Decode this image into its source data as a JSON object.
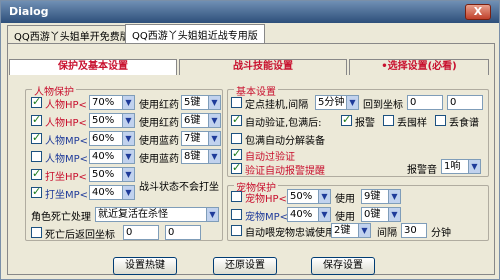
{
  "window": {
    "title": "Dialog",
    "close_label": "X"
  },
  "main_tabs": [
    {
      "label": "QQ西游丫头姐单开免费版"
    },
    {
      "label": "QQ西游丫头姐姐近战专用版"
    }
  ],
  "sub_tabs": [
    {
      "label": "保护及基本设置"
    },
    {
      "label": "战斗技能设置"
    },
    {
      "label": "•选择设置(必看)"
    }
  ],
  "person": {
    "title": "人物保护",
    "rows": [
      {
        "label": "人物HP<",
        "pct": "70%",
        "action": "使用红药",
        "key": "5键"
      },
      {
        "label": "人物HP<",
        "pct": "50%",
        "action": "使用红药",
        "key": "6键"
      },
      {
        "label": "人物MP<",
        "pct": "60%",
        "action": "使用蓝药",
        "key": "7键"
      },
      {
        "label": "人物MP<",
        "pct": "40%",
        "action": "使用蓝药",
        "key": "8键"
      }
    ],
    "attack_hp": {
      "label": "打坐HP<",
      "pct": "50%"
    },
    "attack_mp": {
      "label": "打坐MP<",
      "pct": "40%"
    },
    "battle_note": "战斗状态不会打坐",
    "death_label": "角色死亡处理",
    "death_value": "就近复活在杀怪",
    "return_label": "死亡后返回坐标",
    "return_x": "0",
    "return_y": "0"
  },
  "basic": {
    "title": "基本设置",
    "fixed_hook": "定点挂机,间隔",
    "interval": "5分钟",
    "return_coord": "回到坐标",
    "coord_x": "0",
    "coord_y": "0",
    "auto_check": "自动验证,包满后:",
    "alarm": "报警",
    "drop_junk": "丢囤样",
    "drop_food": "丢食谱",
    "auto_decompose": "包满自动分解装备",
    "auto_verify": "自动过验证",
    "verify_alert": "验证自动报警提醒",
    "alert_sound_label": "报警音",
    "alert_sound_value": "1响"
  },
  "pet": {
    "title": "宠物保护",
    "hp": {
      "label": "宠物HP<",
      "pct": "50%",
      "action": "使用",
      "key": "9键"
    },
    "mp": {
      "label": "宠物MP<",
      "pct": "40%",
      "action": "使用",
      "key": "0键"
    },
    "loyalty": {
      "label": "自动喂宠物忠诚使用",
      "key": "2键",
      "interval_label": "间隔",
      "interval": "30",
      "unit": "分钟"
    }
  },
  "buttons": {
    "hotkey": "设置热键",
    "restore": "还原设置",
    "save": "保存设置"
  }
}
